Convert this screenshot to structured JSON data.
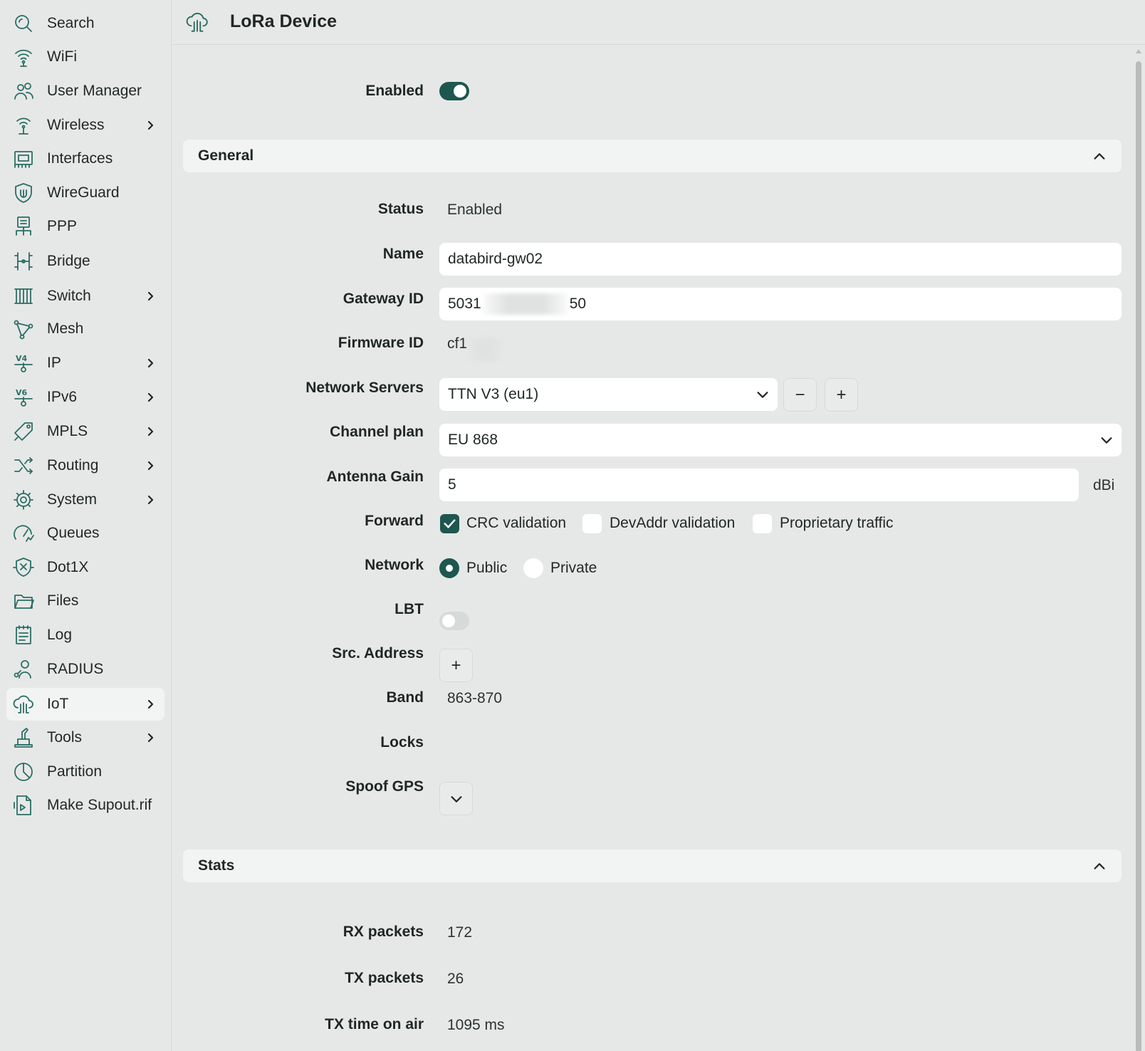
{
  "sidebar": {
    "items": [
      {
        "label": "Search",
        "icon": "search-icon",
        "chevron": false
      },
      {
        "label": "WiFi",
        "icon": "wifi-icon",
        "chevron": false
      },
      {
        "label": "User Manager",
        "icon": "users-icon",
        "chevron": false
      },
      {
        "label": "Wireless",
        "icon": "antenna-icon",
        "chevron": true
      },
      {
        "label": "Interfaces",
        "icon": "interfaces-icon",
        "chevron": false
      },
      {
        "label": "WireGuard",
        "icon": "shield-icon",
        "chevron": false
      },
      {
        "label": "PPP",
        "icon": "ppp-icon",
        "chevron": false
      },
      {
        "label": "Bridge",
        "icon": "bridge-icon",
        "chevron": false
      },
      {
        "label": "Switch",
        "icon": "switch-icon",
        "chevron": true
      },
      {
        "label": "Mesh",
        "icon": "mesh-icon",
        "chevron": false
      },
      {
        "label": "IP",
        "icon": "ipv4-icon",
        "chevron": true
      },
      {
        "label": "IPv6",
        "icon": "ipv6-icon",
        "chevron": true
      },
      {
        "label": "MPLS",
        "icon": "tag-icon",
        "chevron": true
      },
      {
        "label": "Routing",
        "icon": "routing-icon",
        "chevron": true
      },
      {
        "label": "System",
        "icon": "gear-icon",
        "chevron": true
      },
      {
        "label": "Queues",
        "icon": "gauge-icon",
        "chevron": false
      },
      {
        "label": "Dot1X",
        "icon": "dot1x-icon",
        "chevron": false
      },
      {
        "label": "Files",
        "icon": "folder-icon",
        "chevron": false
      },
      {
        "label": "Log",
        "icon": "log-icon",
        "chevron": false
      },
      {
        "label": "RADIUS",
        "icon": "radius-icon",
        "chevron": false
      },
      {
        "label": "IoT",
        "icon": "iot-icon",
        "chevron": true,
        "active": true
      },
      {
        "label": "Tools",
        "icon": "tools-icon",
        "chevron": true
      },
      {
        "label": "Partition",
        "icon": "partition-icon",
        "chevron": false
      },
      {
        "label": "Make Supout.rif",
        "icon": "supout-icon",
        "chevron": false
      }
    ]
  },
  "header": {
    "title": "LoRa Device",
    "icon": "iot-icon"
  },
  "form": {
    "enabled_label": "Enabled",
    "enabled": true,
    "general_title": "General",
    "status_label": "Status",
    "status_value": "Enabled",
    "name_label": "Name",
    "name_value": "databird-gw02",
    "gateway_label": "Gateway ID",
    "gateway_prefix": "5031",
    "gateway_suffix": "50",
    "firmware_label": "Firmware ID",
    "firmware_prefix": "cf1",
    "network_servers_label": "Network Servers",
    "network_servers_value": "TTN V3 (eu1)",
    "minus_label": "−",
    "plus_label": "+",
    "channel_plan_label": "Channel plan",
    "channel_plan_value": "EU 868",
    "antenna_gain_label": "Antenna Gain",
    "antenna_gain_value": "5",
    "antenna_gain_unit": "dBi",
    "forward_label": "Forward",
    "forward_options": [
      "CRC validation",
      "DevAddr validation",
      "Proprietary traffic"
    ],
    "network_label": "Network",
    "network_options": [
      "Public",
      "Private"
    ],
    "lbt_label": "LBT",
    "lbt": false,
    "src_address_label": "Src. Address",
    "band_label": "Band",
    "band_value": "863-870",
    "locks_label": "Locks",
    "spoof_gps_label": "Spoof GPS"
  },
  "stats": {
    "title": "Stats",
    "rx_label": "RX packets",
    "rx_value": "172",
    "tx_label": "TX packets",
    "tx_value": "26",
    "air_label": "TX time on air",
    "air_value": "1095 ms"
  },
  "colors": {
    "accent": "#1e5650",
    "icon": "#2b6e64",
    "background": "#e6e8e7"
  }
}
